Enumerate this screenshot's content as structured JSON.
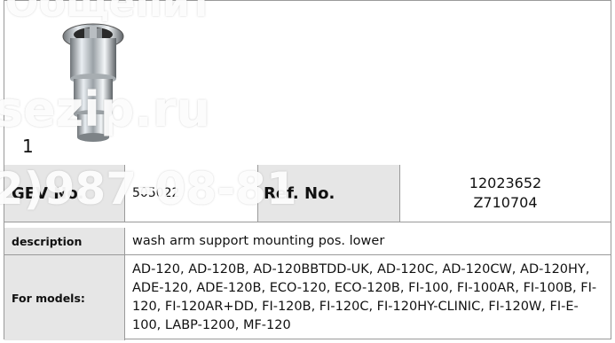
{
  "item_number": "1",
  "ids": {
    "gev_label": "GEV No.",
    "gev_value": "505022",
    "ref_label": "Ref. No.",
    "ref_values": [
      "12023652",
      "Z710704"
    ]
  },
  "description": {
    "label": "description",
    "value": "wash arm support  mounting pos. lower"
  },
  "models": {
    "label": "For models:",
    "value": "AD-120, AD-120B, AD-120BBTDD-UK, AD-120C, AD-120CW, AD-120HY, ADE-120, ADE-120B, ECO-120, ECO-120B, FI-100, FI-100AR, FI-100B, FI-120, FI-120AR+DD, FI-120B, FI-120C, FI-120HY-CLINIC, FI-120W, FI-E-100, LABP-1200, MF-120"
  },
  "watermarks": {
    "top": "Общепит",
    "middle": "sezip.ru",
    "phone": "2)987-08-81"
  },
  "colors": {
    "label_bg": "#e6e6e6",
    "border": "#9a9a9a",
    "watermark": "#ffffff"
  }
}
